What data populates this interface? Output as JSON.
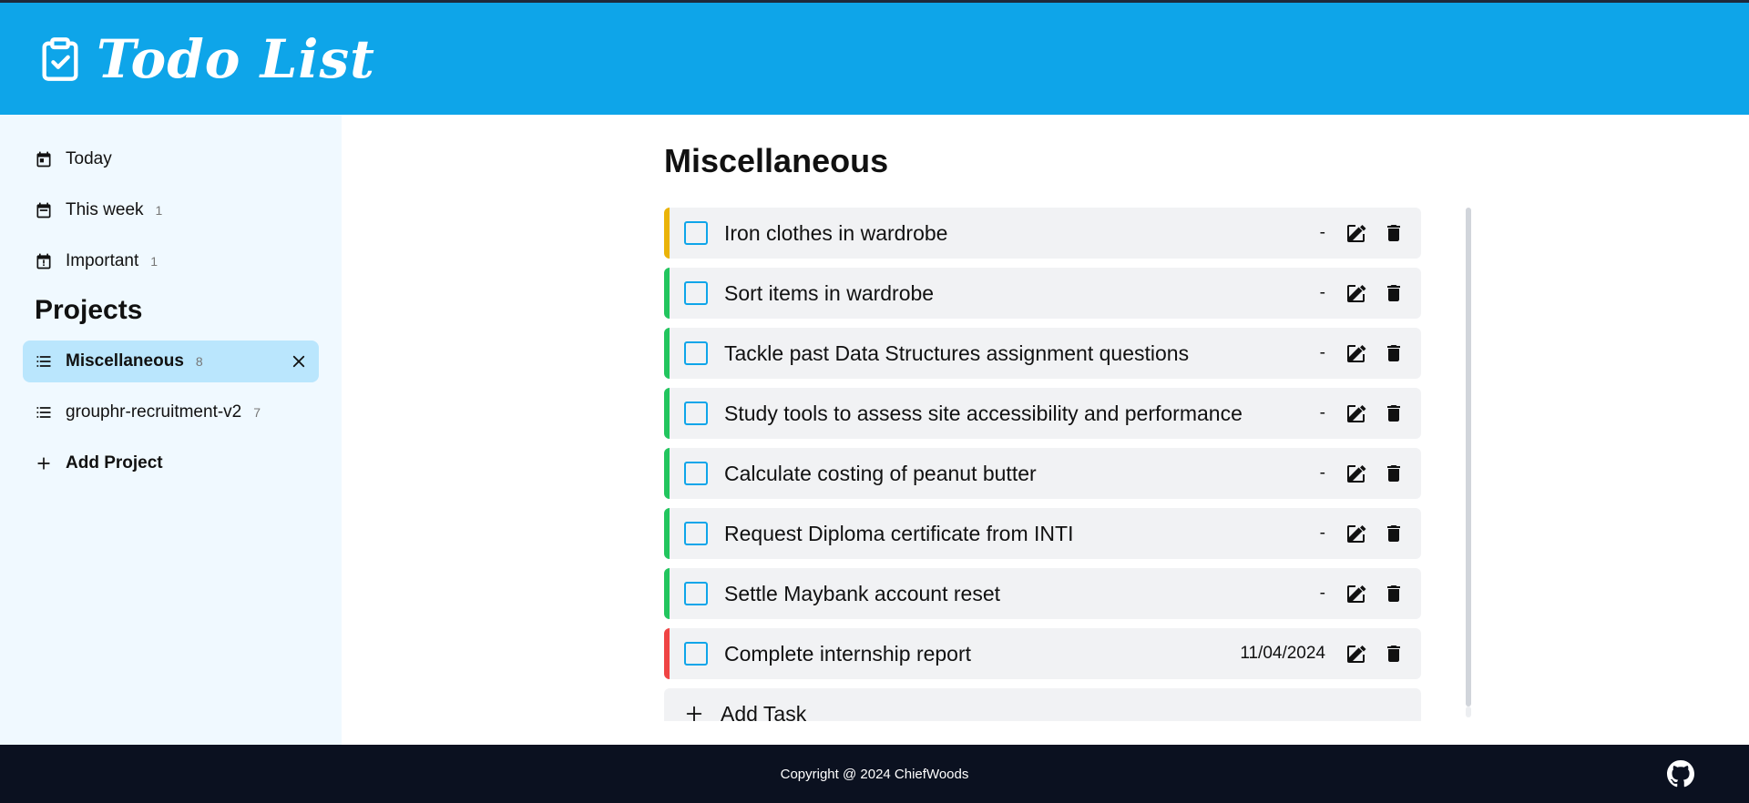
{
  "header": {
    "title": "Todo List",
    "logo_icon": "clipboard-check-icon",
    "bg_color": "#0ea5e9"
  },
  "sidebar": {
    "filters": [
      {
        "label": "Today",
        "count": "",
        "icon": "calendar-icon"
      },
      {
        "label": "This week",
        "count": "1",
        "icon": "calendar-icon"
      },
      {
        "label": "Important",
        "count": "1",
        "icon": "calendar-alert-icon"
      }
    ],
    "projects_heading": "Projects",
    "projects": [
      {
        "label": "Miscellaneous",
        "count": "8",
        "active": true
      },
      {
        "label": "grouphr-recruitment-v2",
        "count": "7",
        "active": false
      }
    ],
    "add_project_label": "Add Project"
  },
  "main": {
    "title": "Miscellaneous",
    "tasks": [
      {
        "name": "Iron clothes in wardrobe",
        "due": "-",
        "priority_color": "#eab308"
      },
      {
        "name": "Sort items in wardrobe",
        "due": "-",
        "priority_color": "#22c55e"
      },
      {
        "name": "Tackle past Data Structures assignment questions",
        "due": "-",
        "priority_color": "#22c55e"
      },
      {
        "name": "Study tools to assess site accessibility and performance",
        "due": "-",
        "priority_color": "#22c55e"
      },
      {
        "name": "Calculate costing of peanut butter",
        "due": "-",
        "priority_color": "#22c55e"
      },
      {
        "name": "Request Diploma certificate from INTI",
        "due": "-",
        "priority_color": "#22c55e"
      },
      {
        "name": "Settle Maybank account reset",
        "due": "-",
        "priority_color": "#22c55e"
      },
      {
        "name": "Complete internship report",
        "due": "11/04/2024",
        "priority_color": "#ef4444"
      }
    ],
    "add_task_label": "Add Task"
  },
  "footer": {
    "copyright": "Copyright @ 2024 ChiefWoods",
    "github_icon": "github-icon"
  }
}
